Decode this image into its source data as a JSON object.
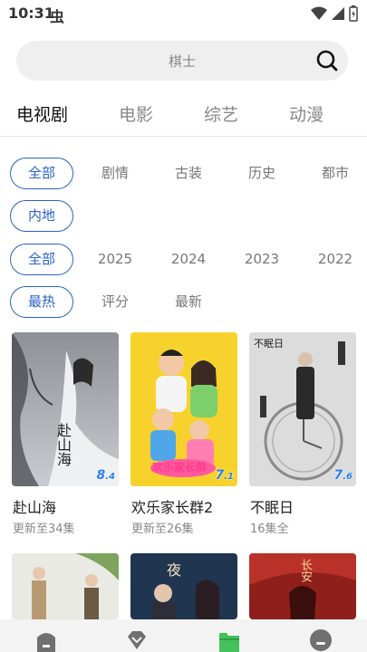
{
  "status": {
    "time": "10:31",
    "glyph": "虫"
  },
  "search": {
    "placeholder": "棋士"
  },
  "top_tabs": [
    {
      "label": "电视剧",
      "active": true
    },
    {
      "label": "电影",
      "active": false
    },
    {
      "label": "综艺",
      "active": false
    },
    {
      "label": "动漫",
      "active": false
    }
  ],
  "filters": {
    "genre": [
      "全部",
      "剧情",
      "古装",
      "历史",
      "都市"
    ],
    "region": [
      "内地"
    ],
    "year": [
      "全部",
      "2025",
      "2024",
      "2023",
      "2022"
    ],
    "sort": [
      "最热",
      "评分",
      "最新"
    ]
  },
  "cards": [
    {
      "title": "赴山海",
      "subtitle": "更新至34集",
      "rating_int": "8",
      "rating_dec": ".4"
    },
    {
      "title": "欢乐家长群2",
      "subtitle": "更新至26集",
      "rating_int": "7",
      "rating_dec": ".1"
    },
    {
      "title": "不眠日",
      "subtitle": "16集全",
      "rating_int": "7",
      "rating_dec": ".6"
    }
  ],
  "poster_texts": {
    "card1": "赴山海",
    "card2": "欢乐家长群",
    "card3": "不眠日",
    "card5": "长安"
  },
  "colors": {
    "accent": "#2a62c9",
    "rating": "#2e7ff0",
    "nav_active": "#43c15a"
  },
  "bottom_nav": [
    {
      "icon": "home-icon",
      "active": false
    },
    {
      "icon": "gem-icon",
      "active": false
    },
    {
      "icon": "folder-icon",
      "active": true
    },
    {
      "icon": "profile-icon",
      "active": false
    }
  ]
}
